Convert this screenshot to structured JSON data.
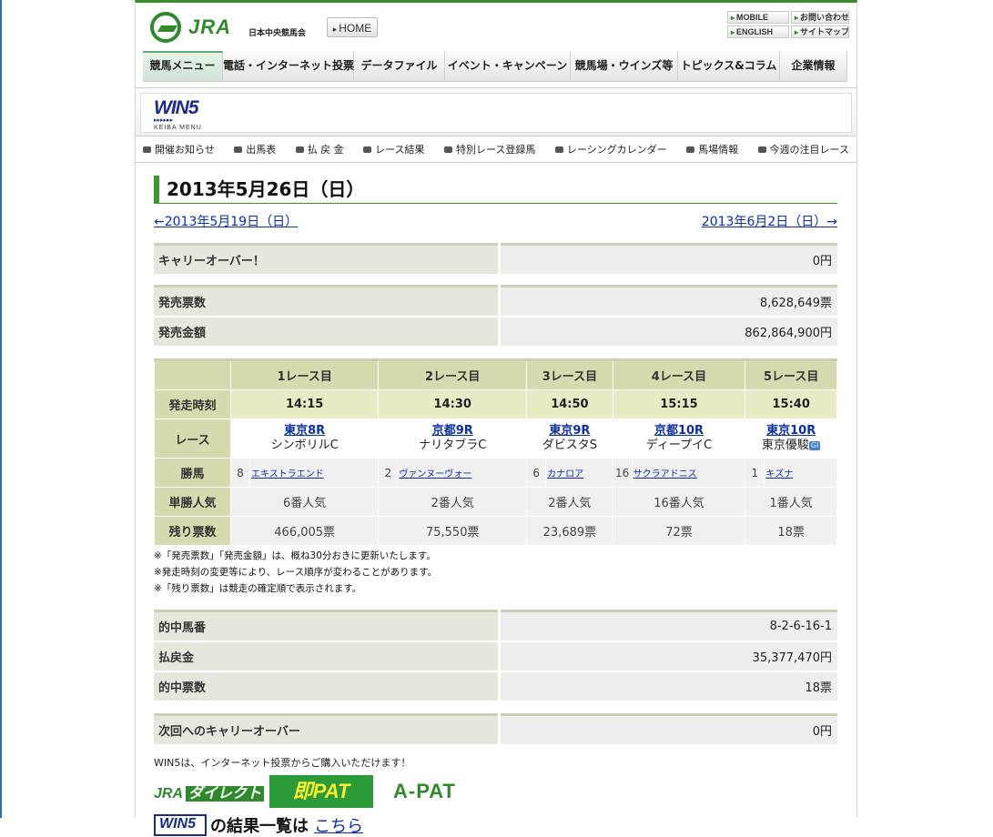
{
  "header": {
    "logo": "JRA",
    "logo_sub": "日本中央競馬会",
    "home": "HOME",
    "util": [
      "MOBILE",
      "お問い合わせ",
      "ENGLISH",
      "サイトマップ"
    ]
  },
  "gnav": [
    "競馬メニュー",
    "電話・インターネット投票",
    "データファイル",
    "イベント・キャンペーン",
    "競馬場・ウインズ等",
    "トピックス&コラム",
    "企業情報"
  ],
  "banner": {
    "win5": "WIN5",
    "arrows": "▸▸▸▸▸▸",
    "keiba_menu": "KEIBA MENU"
  },
  "subnav": [
    "開催お知らせ",
    "出馬表",
    "払 戻 金",
    "レース結果",
    "特別レース登録馬",
    "レーシングカレンダー",
    "馬場情報",
    "今週の注目レース"
  ],
  "title": "2013年5月26日（日）",
  "prev_link": "←2013年5月19日（日）",
  "next_link": "2013年6月2日（日）→",
  "carryover": {
    "label": "キャリーオーバー！",
    "value": "0円"
  },
  "sales": {
    "count_label": "発売票数",
    "count_value": "8,628,649票",
    "amount_label": "発売金額",
    "amount_value": "862,864,900円"
  },
  "races": {
    "row_labels": [
      "発走時刻",
      "レース",
      "勝馬",
      "単勝人気",
      "残り票数"
    ],
    "headers": [
      "1レース目",
      "2レース目",
      "3レース目",
      "4レース目",
      "5レース目"
    ],
    "times": [
      "14:15",
      "14:30",
      "14:50",
      "15:15",
      "15:40"
    ],
    "race_links": [
      "東京8R",
      "京都9R",
      "東京9R",
      "京都10R",
      "東京10R"
    ],
    "race_names": [
      "シンボリルC",
      "ナリタブラC",
      "ダビスタS",
      "ディープイC",
      "東京優駿"
    ],
    "grade": "GI",
    "winner_nums": [
      "8",
      "2",
      "6",
      "16",
      "1"
    ],
    "winners": [
      "エキストラエンド",
      "ヴァンヌーヴォー",
      "カナロア",
      "サクラアドニス",
      "キズナ"
    ],
    "popularity": [
      "6番人気",
      "2番人気",
      "2番人気",
      "16番人気",
      "1番人気"
    ],
    "remaining": [
      "466,005票",
      "75,550票",
      "23,689票",
      "72票",
      "18票"
    ]
  },
  "notes": [
    "※「発売票数」「発売金額」は、概ね30分おきに更新いたします。",
    "※発走時刻の変更等により、レース順序が変わることがあります。",
    "※「残り票数」は競走の確定順で表示されます。"
  ],
  "result": {
    "hit_label": "的中馬番",
    "hit_value": "8-2-6-16-1",
    "payout_label": "払戻金",
    "payout_value": "35,377,470円",
    "tickets_label": "的中票数",
    "tickets_value": "18票"
  },
  "next_carry": {
    "label": "次回へのキャリーオーバー",
    "value": "0円"
  },
  "bottom": {
    "text": "WIN5は、インターネット投票からご購入いただけます！",
    "jra_direct": "JRA",
    "jra_direct_b": "ダイレクト",
    "sokupat": "即PAT",
    "apat": "A-PAT",
    "win5_small": "WIN5",
    "result_text": "の結果一覧は",
    "result_link": "こちら"
  }
}
